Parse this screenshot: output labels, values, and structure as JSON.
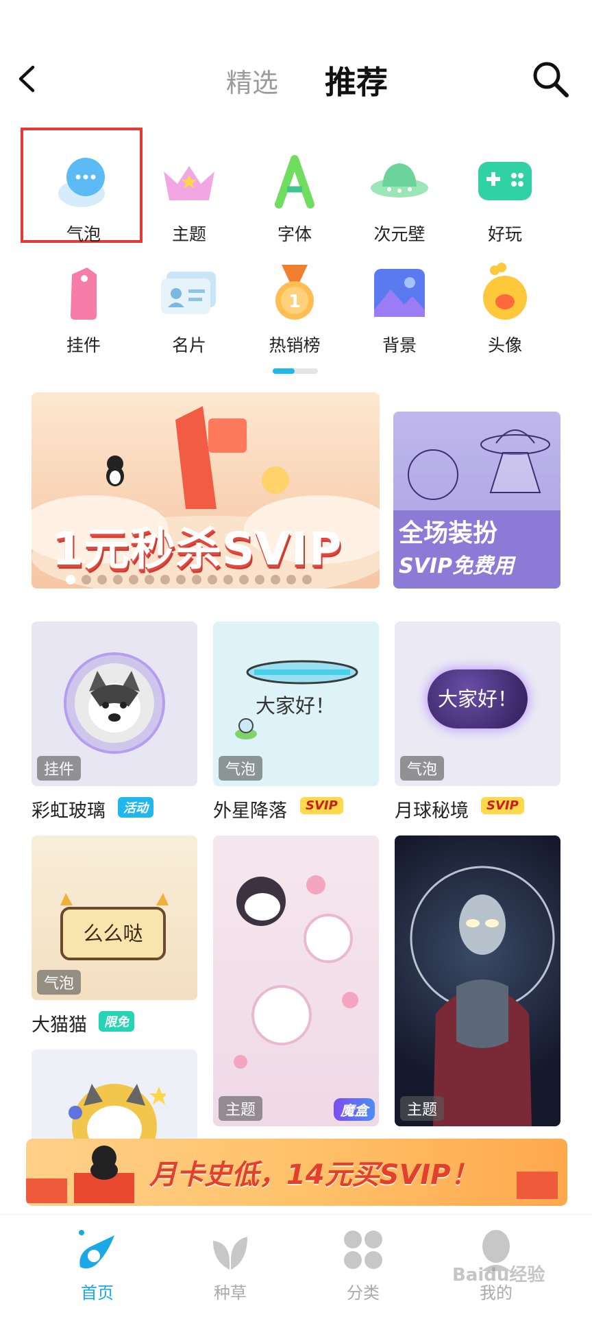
{
  "header": {
    "tab_featured": "精选",
    "tab_recommend": "推荐"
  },
  "categories": [
    {
      "label": "气泡",
      "icon": "bubble-icon"
    },
    {
      "label": "主题",
      "icon": "crown-icon"
    },
    {
      "label": "字体",
      "icon": "font-icon"
    },
    {
      "label": "次元壁",
      "icon": "ufo-icon"
    },
    {
      "label": "好玩",
      "icon": "gamepad-icon"
    },
    {
      "label": "挂件",
      "icon": "pendant-icon"
    },
    {
      "label": "名片",
      "icon": "card-icon"
    },
    {
      "label": "热销榜",
      "icon": "medal-icon"
    },
    {
      "label": "背景",
      "icon": "picture-icon"
    },
    {
      "label": "头像",
      "icon": "avatar-icon"
    }
  ],
  "banners": {
    "main_text": "1元秒杀SVIP",
    "side_line1": "全场装扮",
    "side_line2": "SVIP免费用"
  },
  "cards": [
    {
      "tag": "挂件",
      "title": "彩虹玻璃",
      "badge": "活动"
    },
    {
      "tag": "气泡",
      "title": "外星降落",
      "badge": "SVIP",
      "bubble_text": "大家好！"
    },
    {
      "tag": "气泡",
      "title": "月球秘境",
      "badge": "SVIP",
      "bubble_text": "大家好！"
    },
    {
      "tag": "气泡",
      "title": "大猫猫",
      "badge": "限免",
      "bubble_text": "么么哒"
    },
    {
      "tag": "主题",
      "corner": "魔盒"
    },
    {
      "tag": "主题"
    }
  ],
  "promo": {
    "text": "月卡史低，14元买SVIP！"
  },
  "nav": [
    {
      "label": "首页",
      "active": true
    },
    {
      "label": "种草"
    },
    {
      "label": "分类"
    },
    {
      "label": "我的"
    }
  ],
  "watermark": "Baidu经验",
  "colors": {
    "accent": "#1aa8e6",
    "highlight": "#e53935",
    "svip_badge": "#ffd84c",
    "activity_badge": "#21b7ee",
    "free_badge": "#25d3b5"
  }
}
